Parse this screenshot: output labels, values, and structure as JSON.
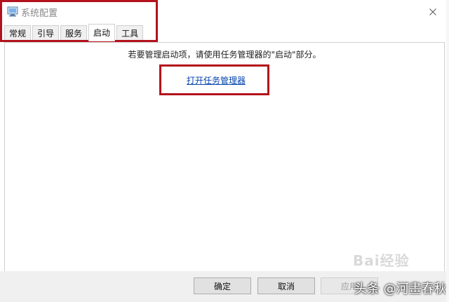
{
  "window": {
    "title": "系统配置",
    "close_glyph": "×"
  },
  "tabs": [
    {
      "label": "常规",
      "active": false
    },
    {
      "label": "引导",
      "active": false
    },
    {
      "label": "服务",
      "active": false
    },
    {
      "label": "启动",
      "active": true
    },
    {
      "label": "工具",
      "active": false
    }
  ],
  "startup": {
    "notice": "若要管理启动项，请使用任务管理器的\"启动\"部分。",
    "link": "打开任务管理器"
  },
  "buttons": {
    "ok": "确定",
    "cancel": "取消",
    "apply": "应用"
  },
  "watermarks": {
    "baidu": "Bai经验",
    "toutiao": "头条 @河畫春秋"
  },
  "colors": {
    "highlight": "#b3121c",
    "link": "#0645ad"
  }
}
